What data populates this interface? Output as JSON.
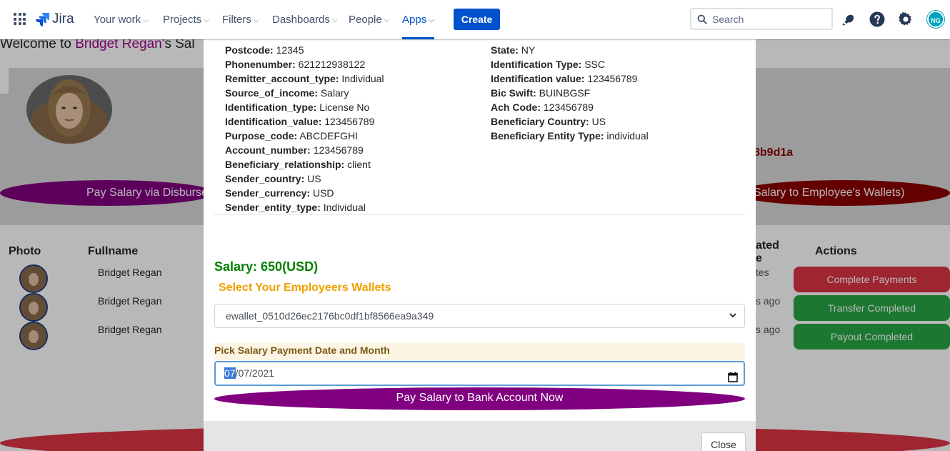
{
  "topnav": {
    "logo": "Jira",
    "items": [
      {
        "label": "Your work"
      },
      {
        "label": "Projects"
      },
      {
        "label": "Filters"
      },
      {
        "label": "Dashboards"
      },
      {
        "label": "People"
      },
      {
        "label": "Apps"
      }
    ],
    "active_item": "Apps",
    "create_label": "Create",
    "search_placeholder": "Search",
    "avatar_initials": "NG",
    "accent_color": "#0052cc",
    "icons": [
      "app-switcher-icon",
      "notifications-icon",
      "help-icon",
      "settings-icon"
    ]
  },
  "background": {
    "welcome_prefix": "Welcome to ",
    "welcome_name": "Bridget Regan",
    "welcome_suffix": "'s Sal",
    "wallet_id_fragment": "8b9d1a",
    "pill_left": "Pay Salary via Disburse",
    "pill_right": "Salary to Employee's Wallets)",
    "table": {
      "headers": {
        "photo": "Photo",
        "fullname": "Fullname",
        "created": "ated\ne",
        "actions": "Actions"
      },
      "rows": [
        {
          "name": "Bridget Regan",
          "date": "tes",
          "action": "Complete Payments"
        },
        {
          "name": "Bridget Regan",
          "date": "s ago",
          "action": "Transfer Completed"
        },
        {
          "name": "Bridget Regan",
          "date": "s ago",
          "action": "Payout Completed"
        }
      ]
    }
  },
  "modal": {
    "details_left": [
      {
        "label": "Postcode:",
        "value": "12345"
      },
      {
        "label": "Phonenumber:",
        "value": "621212938122"
      },
      {
        "label": "Remitter_account_type:",
        "value": "Individual"
      },
      {
        "label": "Source_of_income:",
        "value": "Salary"
      },
      {
        "label": "Identification_type:",
        "value": "License No"
      },
      {
        "label": "Identification_value:",
        "value": "123456789"
      },
      {
        "label": "Purpose_code:",
        "value": "ABCDEFGHI"
      },
      {
        "label": "Account_number:",
        "value": "123456789"
      },
      {
        "label": "Beneficiary_relationship:",
        "value": "client"
      },
      {
        "label": "Sender_country:",
        "value": "US"
      },
      {
        "label": "Sender_currency:",
        "value": "USD"
      },
      {
        "label": "Sender_entity_type:",
        "value": "Individual"
      }
    ],
    "details_right": [
      {
        "label": "State:",
        "value": "NY"
      },
      {
        "label": "Identification Type:",
        "value": "SSC"
      },
      {
        "label": "Identification value:",
        "value": "123456789"
      },
      {
        "label": "Bic Swift:",
        "value": "BUINBGSF"
      },
      {
        "label": "Ach Code:",
        "value": "123456789"
      },
      {
        "label": "Beneficiary Country:",
        "value": "US"
      },
      {
        "label": "Beneficiary Entity Type:",
        "value": "individual"
      }
    ],
    "salary": "Salary: 650(USD)",
    "select_title": "Select Your Employeers Wallets",
    "wallet_selected": "ewallet_0510d26ec2176bc0df1bf8566ea9a349",
    "pick_label": "Pick Salary Payment Date and Month",
    "date_month": "07",
    "date_rest": "/07/2021",
    "pay_button": "Pay Salary to Bank Account Now",
    "close_button": "Close",
    "colors": {
      "salary": "#008000",
      "select_title": "#f0a000",
      "pay_button": "#800080"
    }
  }
}
